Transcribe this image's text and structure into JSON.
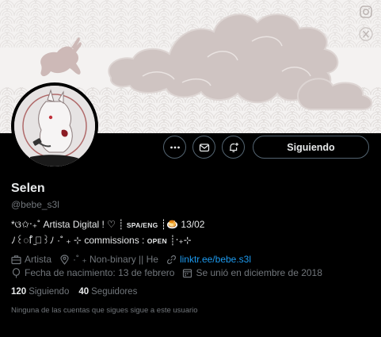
{
  "banner": {
    "icons": [
      "instagram-icon",
      "x-icon"
    ]
  },
  "actions": {
    "more_icon": "more-icon",
    "message_icon": "envelope-icon",
    "notify_icon": "bell-plus-icon",
    "follow_label": "Siguiendo"
  },
  "profile": {
    "name": "Selen",
    "handle": "@bebe_s3l",
    "bio_line1_prefix": "*ଓ✩‧₊˚ Artista Digital ! ♡ ┊",
    "bio_line1_caps": "SPA/ENG",
    "bio_line1_suffix": "┊🍮 13/02",
    "bio_line2_prefix": "ﾉ꒰ꯤ ̫ꯤ꒱ﾉ ·˚ ₊ ⊹     commissions :",
    "bio_line2_caps": "OPEN",
    "bio_line2_suffix": "┊‧₊⊹",
    "profession": "Artista",
    "location": "·˚ ₊     Non-binary || He",
    "link": "linktr.ee/bebe.s3l",
    "birthday": "Fecha de nacimiento: 13 de febrero",
    "joined": "Se unió en diciembre de 2018"
  },
  "stats": {
    "following_count": "120",
    "following_label": "Siguiendo",
    "followers_count": "40",
    "followers_label": "Seguidores"
  },
  "note": "Ninguna de las cuentas que sigues sigue a este usuario",
  "colors": {
    "link": "#1d9bf0",
    "muted": "#71767b",
    "text": "#e7e9ea",
    "background": "#000000"
  }
}
